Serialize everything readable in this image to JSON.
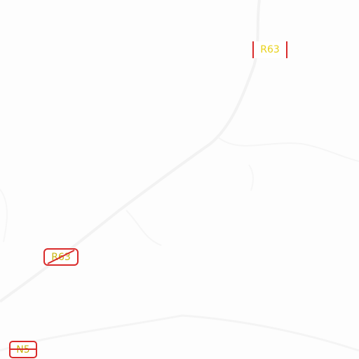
{
  "map": {
    "background_color": "#fdfdfd",
    "road_color": "#f3f3f3",
    "label_text_color": "#e8d21a",
    "label_border_color": "#d92a2a"
  },
  "labels": {
    "r63_top": "R63",
    "r63_mid": "R63",
    "n5": "N5"
  }
}
